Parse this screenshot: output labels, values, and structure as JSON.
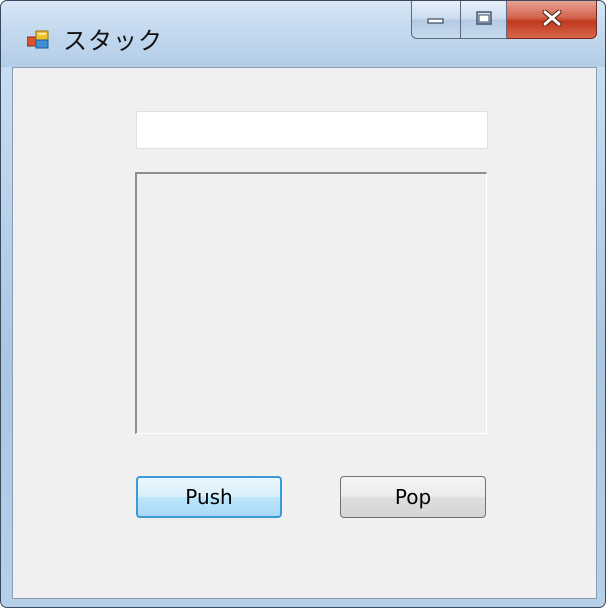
{
  "window": {
    "title": "スタック",
    "caption": {
      "minimize_label": "",
      "maximize_label": "",
      "close_label": "x"
    }
  },
  "form": {
    "input_value": "",
    "list_items": [],
    "push_label": "Push",
    "pop_label": "Pop"
  },
  "colors": {
    "focus_border": "#3c9bd6",
    "close_button": "#c0391d",
    "client_background": "#f0f0f0"
  },
  "icons": {
    "app": "windows-form-icon",
    "minimize": "minimize-icon",
    "maximize": "maximize-icon",
    "close": "close-icon"
  }
}
